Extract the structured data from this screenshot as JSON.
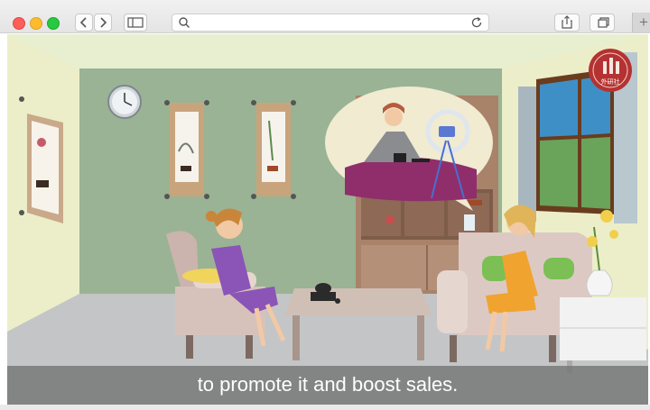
{
  "browser": {
    "toolbar": {
      "back_icon": "chevron-left-icon",
      "forward_icon": "chevron-right-icon",
      "sidebar_icon": "sidebar-icon",
      "search_icon": "search-icon",
      "reload_icon": "reload-icon",
      "share_icon": "share-icon",
      "tabs_icon": "tabs-icon",
      "new_tab_icon": "plus-icon"
    },
    "address_bar": {
      "value": "",
      "placeholder": ""
    }
  },
  "video": {
    "subtitle": "to promote it and boost sales.",
    "logo_text": "外研社",
    "scene_colors": {
      "wall": "#9ab394",
      "side_wall": "#eceec9",
      "floor": "#c4c5c6",
      "subtitle_bar": "#787878"
    }
  }
}
